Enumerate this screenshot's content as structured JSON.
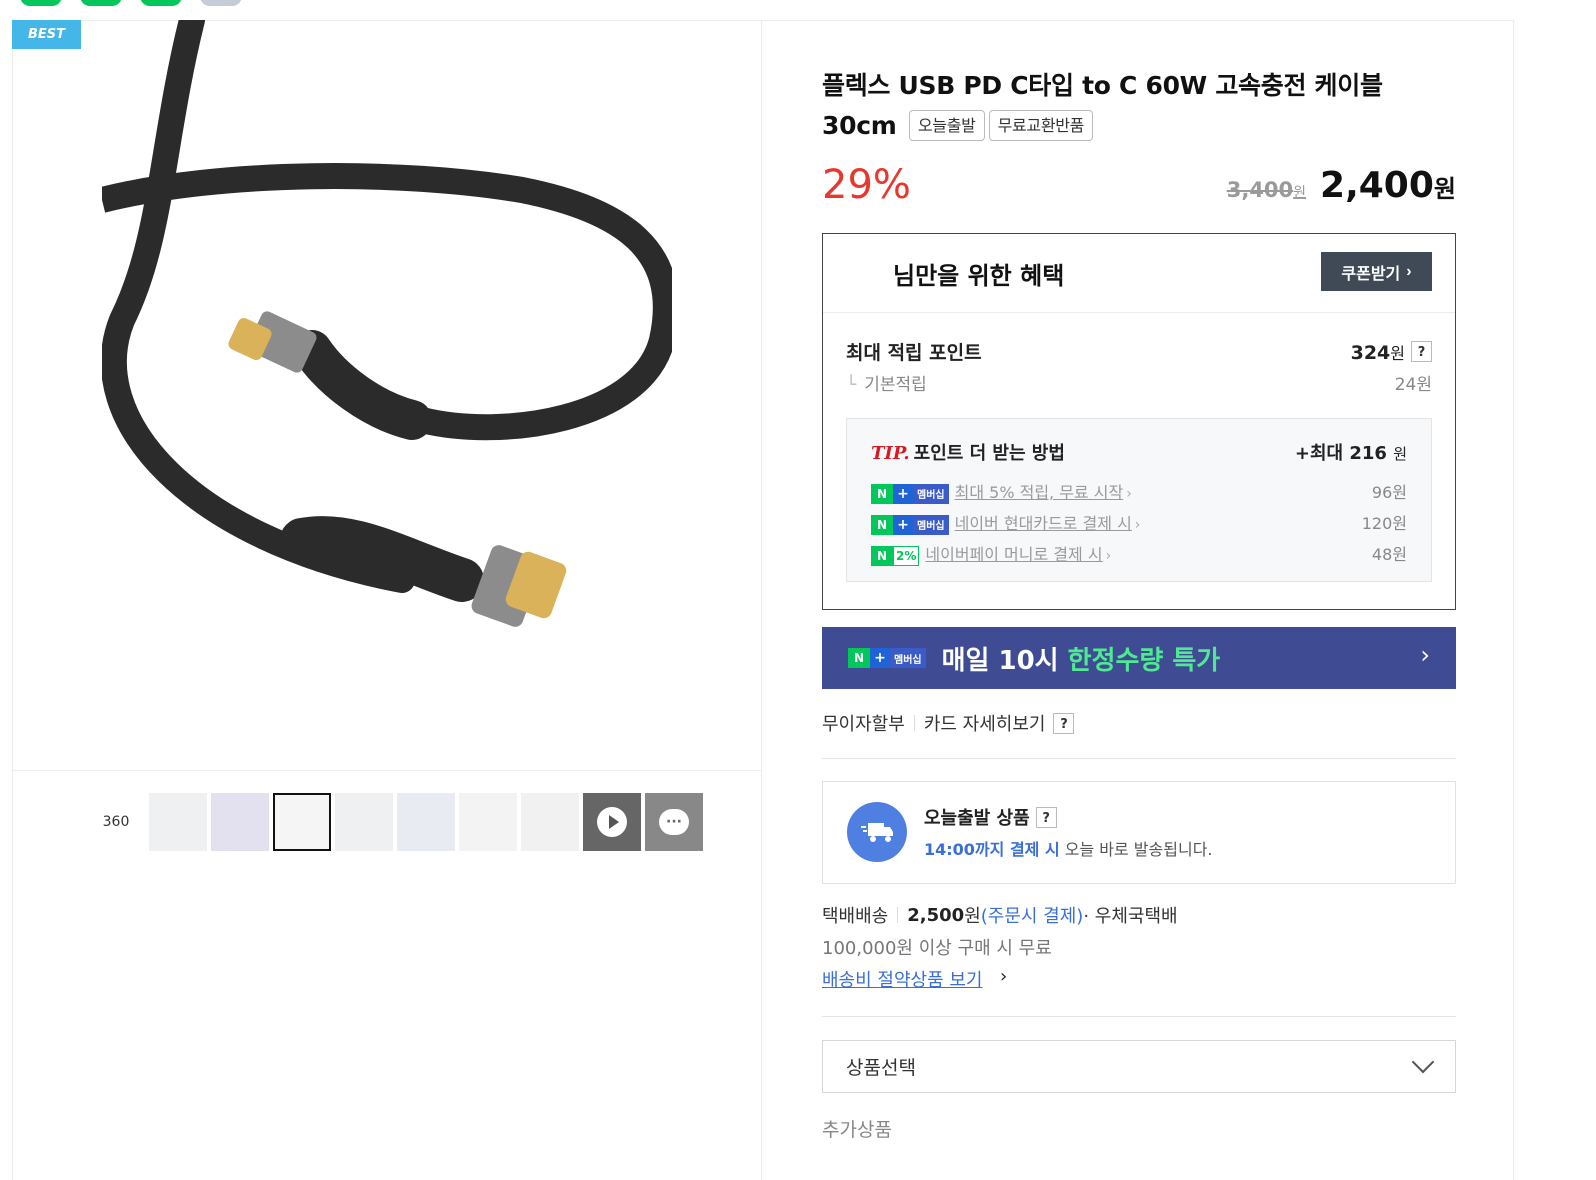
{
  "badge": {
    "best": "BEST"
  },
  "thumbnails": {
    "label_360": "360"
  },
  "product": {
    "title": "플렉스 USB PD C타입 to C 60W 고속충전 케이블 30cm",
    "tags": [
      "오늘출발",
      "무료교환반품"
    ],
    "discount": "29%",
    "original_price": "3,400",
    "original_unit": "원",
    "sale_price": "2,400",
    "sale_unit": "원"
  },
  "benefit": {
    "title": "님만을 위한 혜택",
    "coupon_button": "쿠폰받기",
    "max_point_label": "최대 적립 포인트",
    "max_point_value": "324",
    "max_point_unit": "원",
    "help": "?",
    "basic_label": "기본적립",
    "basic_value": "24원",
    "tip": {
      "prefix": "TIP.",
      "title": "포인트 더 받는 방법",
      "max_label": "+최대 216",
      "max_unit": "원",
      "items": [
        {
          "text": "최대 5% 적립, 무료 시작",
          "value": "96원"
        },
        {
          "text": "네이버 현대카드로 결제 시",
          "value": "120원"
        },
        {
          "text": "네이버페이 머니로 결제 시",
          "value": "48원"
        }
      ],
      "badge_n": "N",
      "badge_plus": "+",
      "badge_membership": "멤버십",
      "badge_pct": "2%"
    }
  },
  "promo": {
    "text_main": "매일 10시 ",
    "text_highlight": "한정수량 특가"
  },
  "installment": {
    "label": "무이자할부",
    "card_detail": "카드 자세히보기",
    "help": "?"
  },
  "today_ship": {
    "title": "오늘출발 상품",
    "help": "?",
    "time": "14:00까지 결제 시",
    "desc": " 오늘 바로 발송됩니다."
  },
  "delivery": {
    "method": "택배배송",
    "fee": "2,500",
    "fee_unit": "원",
    "pay_note": "(주문시 결제)",
    "carrier": " · 우체국택배",
    "free_condition": "100,000원 이상 구매 시 무료",
    "save_link": "배송비 절약상품 보기"
  },
  "options": {
    "select_placeholder": "상품선택",
    "extra_label": "추가상품"
  },
  "colors": {
    "discount": "#e8382e",
    "promo_bg": "#3f4c94",
    "naver_green": "#03c75a",
    "link_blue": "#3a6fd8"
  }
}
